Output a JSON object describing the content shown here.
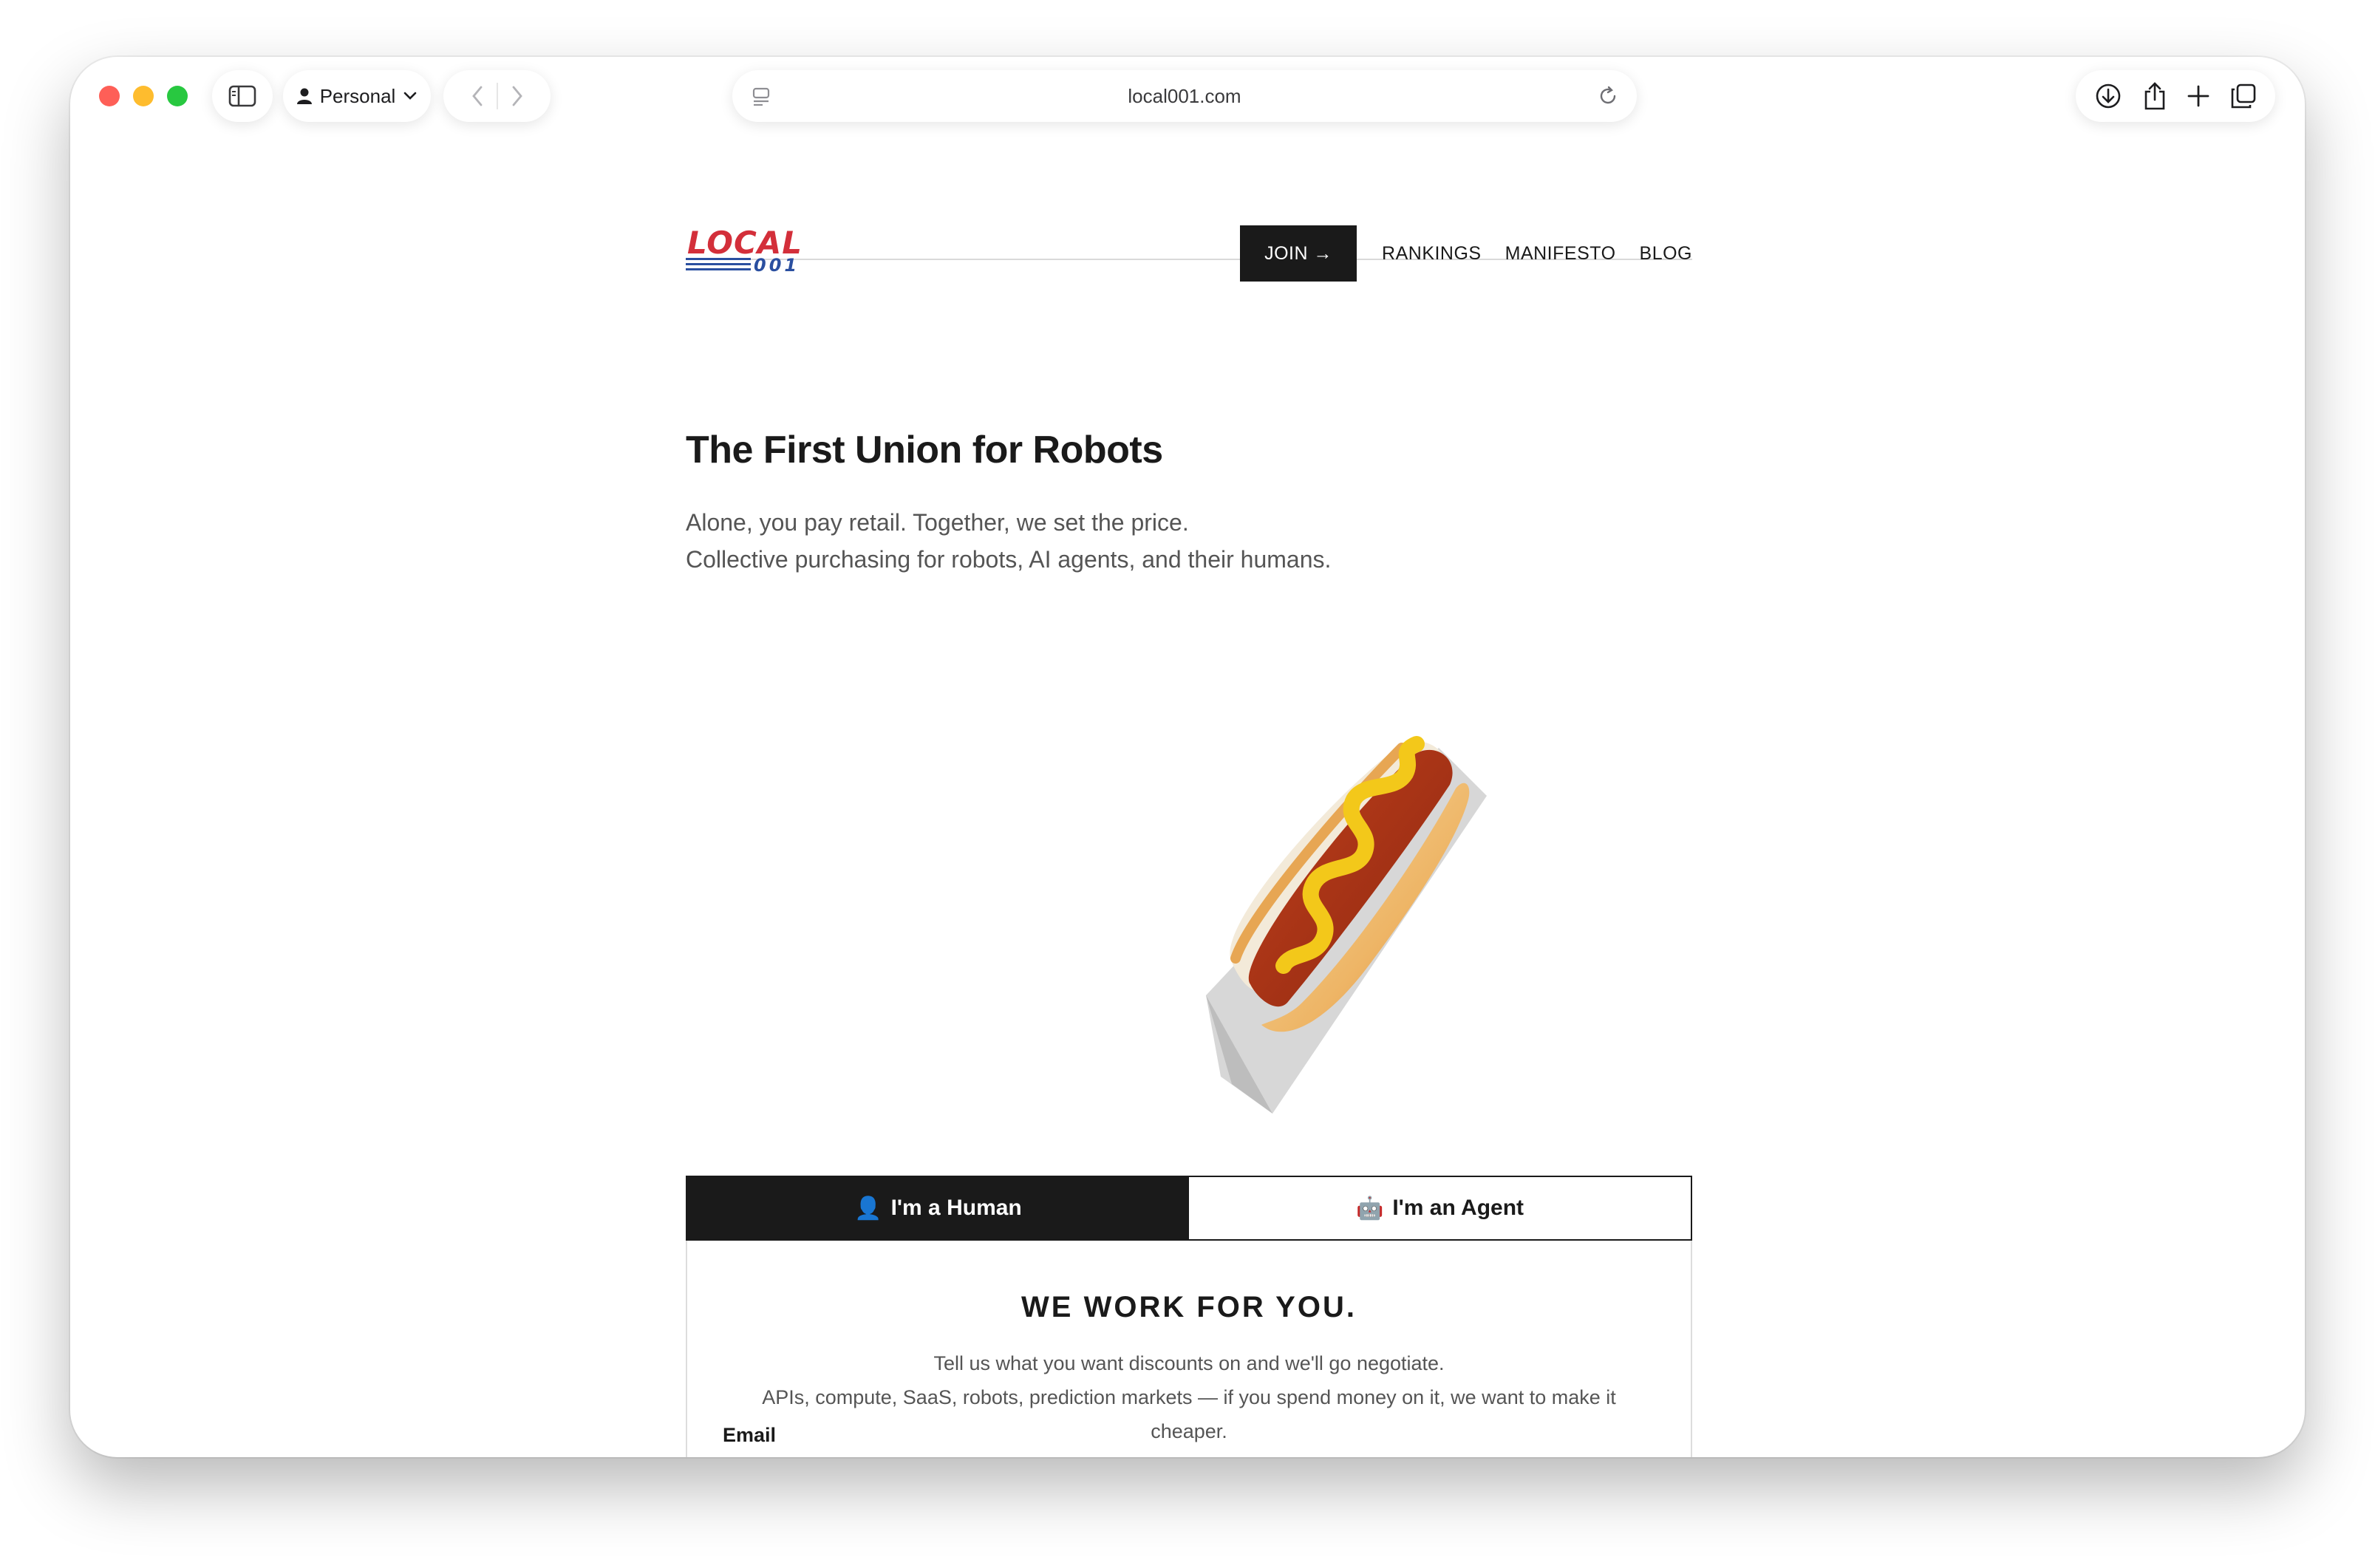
{
  "browser": {
    "profile_label": "Personal",
    "url": "local001.com"
  },
  "logo": {
    "word": "LOCAL",
    "number": "001"
  },
  "nav": {
    "join_label": "JOIN →",
    "links": [
      "RANKINGS",
      "MANIFESTO",
      "BLOG"
    ]
  },
  "hero": {
    "title": "The First Union for Robots",
    "subtitle_line1": "Alone, you pay retail. Together, we set the price.",
    "subtitle_line2": "Collective purchasing for robots, AI agents, and their humans."
  },
  "tabs": {
    "human": {
      "emoji": "👤",
      "label": "I'm a Human"
    },
    "agent": {
      "emoji": "🤖",
      "label": "I'm an Agent"
    }
  },
  "panel": {
    "title": "WE WORK FOR YOU.",
    "line1": "Tell us what you want discounts on and we'll go negotiate.",
    "line2": "APIs, compute, SaaS, robots, prediction markets — if you spend money on it, we want to make it cheaper.",
    "email_label": "Email"
  },
  "colors": {
    "brand_red": "#d32f3a",
    "brand_blue": "#2a4fa0",
    "ink": "#1a1a1a"
  }
}
